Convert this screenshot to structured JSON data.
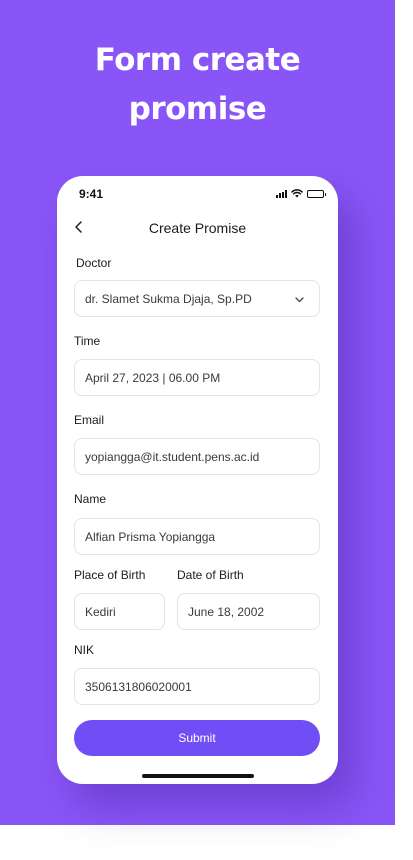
{
  "headline": {
    "line1": "Form create",
    "line2": "promise"
  },
  "status_bar": {
    "time": "9:41",
    "icons": [
      "signal-icon",
      "wifi-icon",
      "battery-icon"
    ]
  },
  "nav": {
    "back_icon": "chevron-left-icon",
    "title": "Create Promise"
  },
  "form": {
    "doctor_label": "Doctor",
    "doctor_value": "dr. Slamet Sukma Djaja, Sp.PD",
    "time_label": "Time",
    "time_value": "April 27, 2023 | 06.00 PM",
    "email_label": "Email",
    "email_value": "yopiangga@it.student.pens.ac.id",
    "name_label": "Name",
    "name_value": "Alfian Prisma Yopiangga",
    "place_of_birth_label": "Place of Birth",
    "place_of_birth_value": "Kediri",
    "date_of_birth_label": "Date of Birth",
    "date_of_birth_value": "June 18, 2002",
    "nik_label": "NIK",
    "nik_value": "3506131806020001",
    "submit_label": "Submit"
  },
  "colors": {
    "background_purple": "#8a55f7",
    "button_purple": "#6f4ef6",
    "field_border": "#e3e3e8"
  }
}
